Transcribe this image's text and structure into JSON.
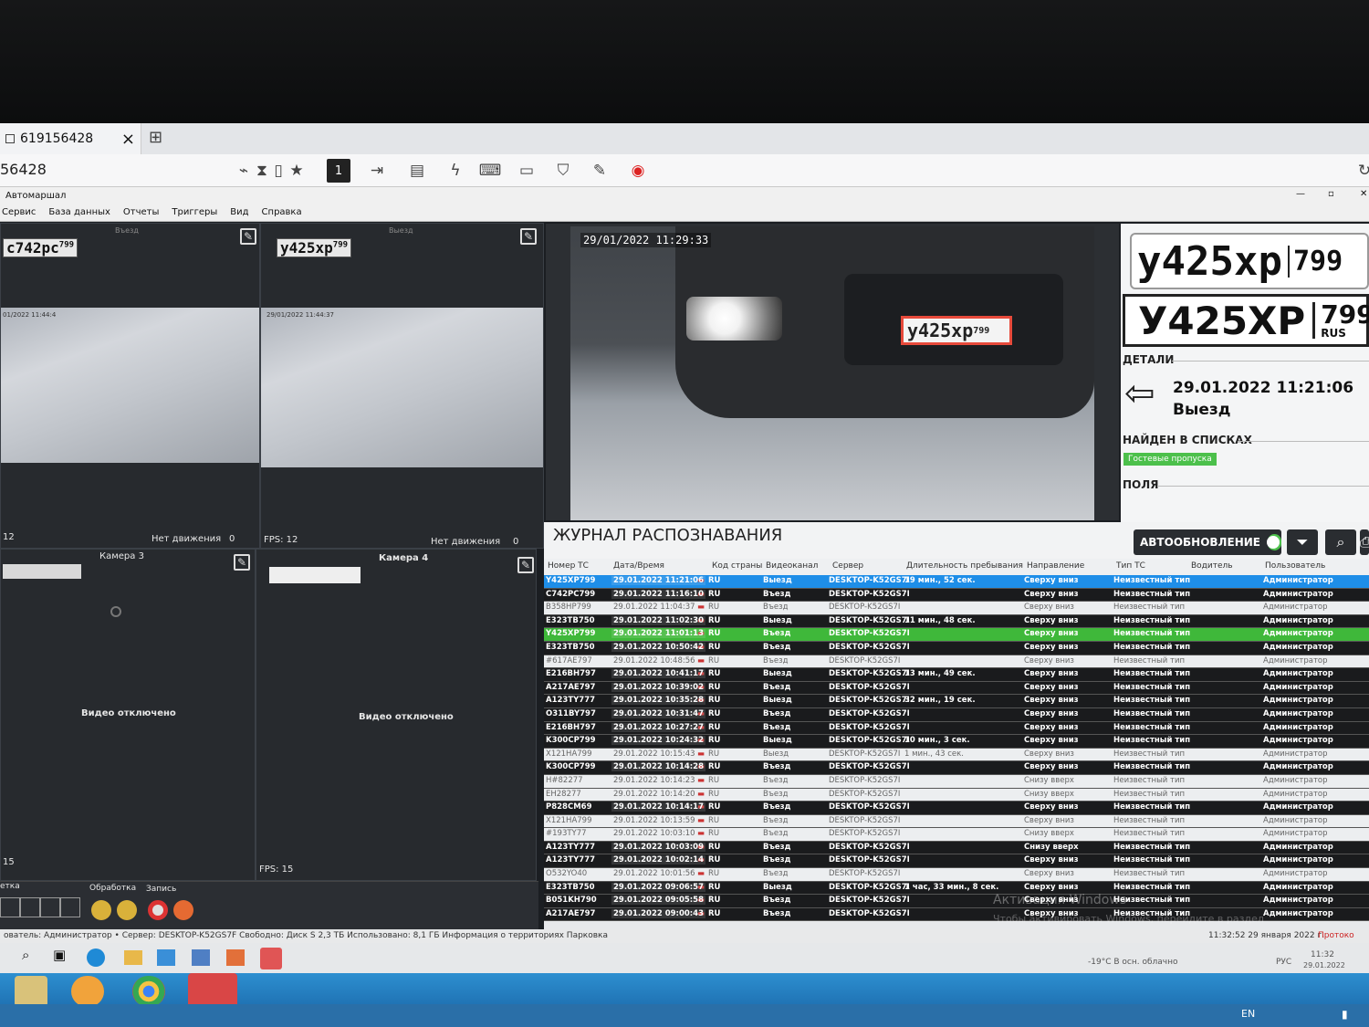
{
  "remote": {
    "tab_title": "619156428",
    "address": "56428",
    "close": "×",
    "new_tab": "⊞"
  },
  "app": {
    "title": "Автомаршал",
    "menu": [
      "Сервис",
      "База данных",
      "Отчеты",
      "Триггеры",
      "Вид",
      "Справка"
    ]
  },
  "cameras": [
    {
      "plate": "с742рс",
      "region": "799",
      "label": "Въезд",
      "fps": "12",
      "motion": "Нет движения",
      "motion_count": "0",
      "stamp": "01/2022 11:44:4"
    },
    {
      "plate": "у425хр",
      "region": "799",
      "label": "Выезд",
      "fps": "FPS: 12",
      "motion": "Нет движения",
      "motion_count": "0",
      "stamp": "29/01/2022 11:44:37"
    },
    {
      "label": "Камера 3",
      "status": "Видео отключено",
      "fps": "15"
    },
    {
      "label": "Камера 4",
      "status": "Видео отключено",
      "fps": "FPS: 15"
    }
  ],
  "controls": {
    "section1": "етка",
    "section2": "Обработка",
    "section3": "Запись"
  },
  "main_view": {
    "timestamp": "29/01/2022 11:29:33",
    "plate": "у425хр",
    "region": "799"
  },
  "details": {
    "plate1": "у425хр",
    "region1": "799",
    "plate2": "У425ХР",
    "region2": "799",
    "country": "RUS",
    "details_label": "ДЕТАЛИ",
    "datetime": "29.01.2022 11:21:06",
    "direction": "Выезд",
    "found_label": "НАЙДЕН В СПИСКАХ",
    "list_badge": "Гостевые пропуска",
    "fields_label": "ПОЛЯ"
  },
  "journal": {
    "title": "ЖУРНАЛ РАСПОЗНАВАНИЯ",
    "auto_label": "АВТООБНОВЛЕНИЕ",
    "auto_on": true,
    "columns": [
      "Номер ТС",
      "Дата/Время",
      "Код страны",
      "Видеоканал",
      "Сервер",
      "Длительность пребывания",
      "Направление",
      "Тип ТС",
      "Водитель",
      "Пользователь"
    ],
    "rows": [
      {
        "plate": "Y425XP799",
        "time": "29.01.2022 11:21:06",
        "code": "RU",
        "channel": "Выезд",
        "server": "DESKTOP-K52GS7I",
        "duration": "19 мин., 52 сек.",
        "direction": "Сверху вниз",
        "type": "Неизвестный тип",
        "user": "Администратор",
        "style": "sel"
      },
      {
        "plate": "C742PC799",
        "time": "29.01.2022 11:16:10",
        "code": "RU",
        "channel": "Въезд",
        "server": "DESKTOP-K52GS7I",
        "duration": "",
        "direction": "Сверху вниз",
        "type": "Неизвестный тип",
        "user": "Администратор",
        "style": "d"
      },
      {
        "plate": "B358HP799",
        "time": "29.01.2022 11:04:37",
        "code": "RU",
        "channel": "Въезд",
        "server": "DESKTOP-K52GS7I",
        "duration": "",
        "direction": "Сверху вниз",
        "type": "Неизвестный тип",
        "user": "Администратор",
        "style": "l"
      },
      {
        "plate": "E323TB750",
        "time": "29.01.2022 11:02:30",
        "code": "RU",
        "channel": "Выезд",
        "server": "DESKTOP-K52GS7I",
        "duration": "11 мин., 48 сек.",
        "direction": "Сверху вниз",
        "type": "Неизвестный тип",
        "user": "Администратор",
        "style": "d"
      },
      {
        "plate": "Y425XP799",
        "time": "29.01.2022 11:01:13",
        "code": "RU",
        "channel": "Въезд",
        "server": "DESKTOP-K52GS7I",
        "duration": "",
        "direction": "Сверху вниз",
        "type": "Неизвестный тип",
        "user": "Администратор",
        "style": "g"
      },
      {
        "plate": "E323TB750",
        "time": "29.01.2022 10:50:42",
        "code": "RU",
        "channel": "Въезд",
        "server": "DESKTOP-K52GS7I",
        "duration": "",
        "direction": "Сверху вниз",
        "type": "Неизвестный тип",
        "user": "Администратор",
        "style": "d"
      },
      {
        "plate": "#617AE797",
        "time": "29.01.2022 10:48:56",
        "code": "RU",
        "channel": "Въезд",
        "server": "DESKTOP-K52GS7I",
        "duration": "",
        "direction": "Сверху вниз",
        "type": "Неизвестный тип",
        "user": "Администратор",
        "style": "l"
      },
      {
        "plate": "E216BH797",
        "time": "29.01.2022 10:41:17",
        "code": "RU",
        "channel": "Выезд",
        "server": "DESKTOP-K52GS7I",
        "duration": "13 мин., 49 сек.",
        "direction": "Сверху вниз",
        "type": "Неизвестный тип",
        "user": "Администратор",
        "style": "d"
      },
      {
        "plate": "A217AE797",
        "time": "29.01.2022 10:39:02",
        "code": "RU",
        "channel": "Въезд",
        "server": "DESKTOP-K52GS7I",
        "duration": "",
        "direction": "Сверху вниз",
        "type": "Неизвестный тип",
        "user": "Администратор",
        "style": "d"
      },
      {
        "plate": "A123TY777",
        "time": "29.01.2022 10:35:28",
        "code": "RU",
        "channel": "Выезд",
        "server": "DESKTOP-K52GS7I",
        "duration": "32 мин., 19 сек.",
        "direction": "Сверху вниз",
        "type": "Неизвестный тип",
        "user": "Администратор",
        "style": "d"
      },
      {
        "plate": "O311BY797",
        "time": "29.01.2022 10:31:47",
        "code": "RU",
        "channel": "Въезд",
        "server": "DESKTOP-K52GS7I",
        "duration": "",
        "direction": "Сверху вниз",
        "type": "Неизвестный тип",
        "user": "Администратор",
        "style": "d"
      },
      {
        "plate": "E216BH797",
        "time": "29.01.2022 10:27:27",
        "code": "RU",
        "channel": "Въезд",
        "server": "DESKTOP-K52GS7I",
        "duration": "",
        "direction": "Сверху вниз",
        "type": "Неизвестный тип",
        "user": "Администратор",
        "style": "d"
      },
      {
        "plate": "K300CP799",
        "time": "29.01.2022 10:24:32",
        "code": "RU",
        "channel": "Выезд",
        "server": "DESKTOP-K52GS7I",
        "duration": "10 мин., 3 сек.",
        "direction": "Сверху вниз",
        "type": "Неизвестный тип",
        "user": "Администратор",
        "style": "d"
      },
      {
        "plate": "X121HA799",
        "time": "29.01.2022 10:15:43",
        "code": "RU",
        "channel": "Выезд",
        "server": "DESKTOP-K52GS7I",
        "duration": "1 мин., 43 сек.",
        "direction": "Сверху вниз",
        "type": "Неизвестный тип",
        "user": "Администратор",
        "style": "l"
      },
      {
        "plate": "K300CP799",
        "time": "29.01.2022 10:14:28",
        "code": "RU",
        "channel": "Въезд",
        "server": "DESKTOP-K52GS7I",
        "duration": "",
        "direction": "Сверху вниз",
        "type": "Неизвестный тип",
        "user": "Администратор",
        "style": "d"
      },
      {
        "plate": "H#82277",
        "time": "29.01.2022 10:14:23",
        "code": "RU",
        "channel": "Въезд",
        "server": "DESKTOP-K52GS7I",
        "duration": "",
        "direction": "Снизу вверх",
        "type": "Неизвестный тип",
        "user": "Администратор",
        "style": "l"
      },
      {
        "plate": "EH28277",
        "time": "29.01.2022 10:14:20",
        "code": "RU",
        "channel": "Въезд",
        "server": "DESKTOP-K52GS7I",
        "duration": "",
        "direction": "Снизу вверх",
        "type": "Неизвестный тип",
        "user": "Администратор",
        "style": "l"
      },
      {
        "plate": "P828CM69",
        "time": "29.01.2022 10:14:17",
        "code": "RU",
        "channel": "Въезд",
        "server": "DESKTOP-K52GS7I",
        "duration": "",
        "direction": "Сверху вниз",
        "type": "Неизвестный тип",
        "user": "Администратор",
        "style": "d"
      },
      {
        "plate": "X121HA799",
        "time": "29.01.2022 10:13:59",
        "code": "RU",
        "channel": "Въезд",
        "server": "DESKTOP-K52GS7I",
        "duration": "",
        "direction": "Сверху вниз",
        "type": "Неизвестный тип",
        "user": "Администратор",
        "style": "l"
      },
      {
        "plate": "#193TY77",
        "time": "29.01.2022 10:03:10",
        "code": "RU",
        "channel": "Въезд",
        "server": "DESKTOP-K52GS7I",
        "duration": "",
        "direction": "Снизу вверх",
        "type": "Неизвестный тип",
        "user": "Администратор",
        "style": "l"
      },
      {
        "plate": "A123TY777",
        "time": "29.01.2022 10:03:09",
        "code": "RU",
        "channel": "Въезд",
        "server": "DESKTOP-K52GS7I",
        "duration": "",
        "direction": "Снизу вверх",
        "type": "Неизвестный тип",
        "user": "Администратор",
        "style": "d"
      },
      {
        "plate": "A123TY777",
        "time": "29.01.2022 10:02:14",
        "code": "RU",
        "channel": "Въезд",
        "server": "DESKTOP-K52GS7I",
        "duration": "",
        "direction": "Сверху вниз",
        "type": "Неизвестный тип",
        "user": "Администратор",
        "style": "d"
      },
      {
        "plate": "O532YO40",
        "time": "29.01.2022 10:01:56",
        "code": "RU",
        "channel": "Въезд",
        "server": "DESKTOP-K52GS7I",
        "duration": "",
        "direction": "Сверху вниз",
        "type": "Неизвестный тип",
        "user": "Администратор",
        "style": "l"
      },
      {
        "plate": "E323TB750",
        "time": "29.01.2022 09:06:57",
        "code": "RU",
        "channel": "Выезд",
        "server": "DESKTOP-K52GS7I",
        "duration": "1 час, 33 мин., 8 сек.",
        "direction": "Сверху вниз",
        "type": "Неизвестный тип",
        "user": "Администратор",
        "style": "d"
      },
      {
        "plate": "B051KH790",
        "time": "29.01.2022 09:05:58",
        "code": "RU",
        "channel": "Въезд",
        "server": "DESKTOP-K52GS7I",
        "duration": "",
        "direction": "Сверху вниз",
        "type": "Неизвестный тип",
        "user": "Администратор",
        "style": "d"
      },
      {
        "plate": "A217AE797",
        "time": "29.01.2022 09:00:43",
        "code": "RU",
        "channel": "Въезд",
        "server": "DESKTOP-K52GS7I",
        "duration": "",
        "direction": "Сверху вниз",
        "type": "Неизвестный тип",
        "user": "Администратор",
        "style": "d"
      }
    ]
  },
  "watermark": {
    "line1": "Активация Windows",
    "line2": "Чтобы активировать Windows, перейдите в раздел"
  },
  "status": {
    "text": "ователь: Администратор • Сервер: DESKTOP-K52GS7F  Свободно: Диск S 2,3 ТБ  Использовано: 8,1 ГБ  Информация о территориях  Парковка",
    "clock": "11:32:52 29 января 2022 г.",
    "protocol": "Протоко"
  },
  "tray": {
    "weather": "-19°C В осн. облачно",
    "lang": "РУС",
    "time": "11:32",
    "date": "29.01.2022",
    "lang2": "EN"
  },
  "colors": {
    "selected": "#1e8ee8",
    "green": "#3fb83a",
    "badge": "#4cc04b",
    "plate_frame": "#e74a3b"
  }
}
